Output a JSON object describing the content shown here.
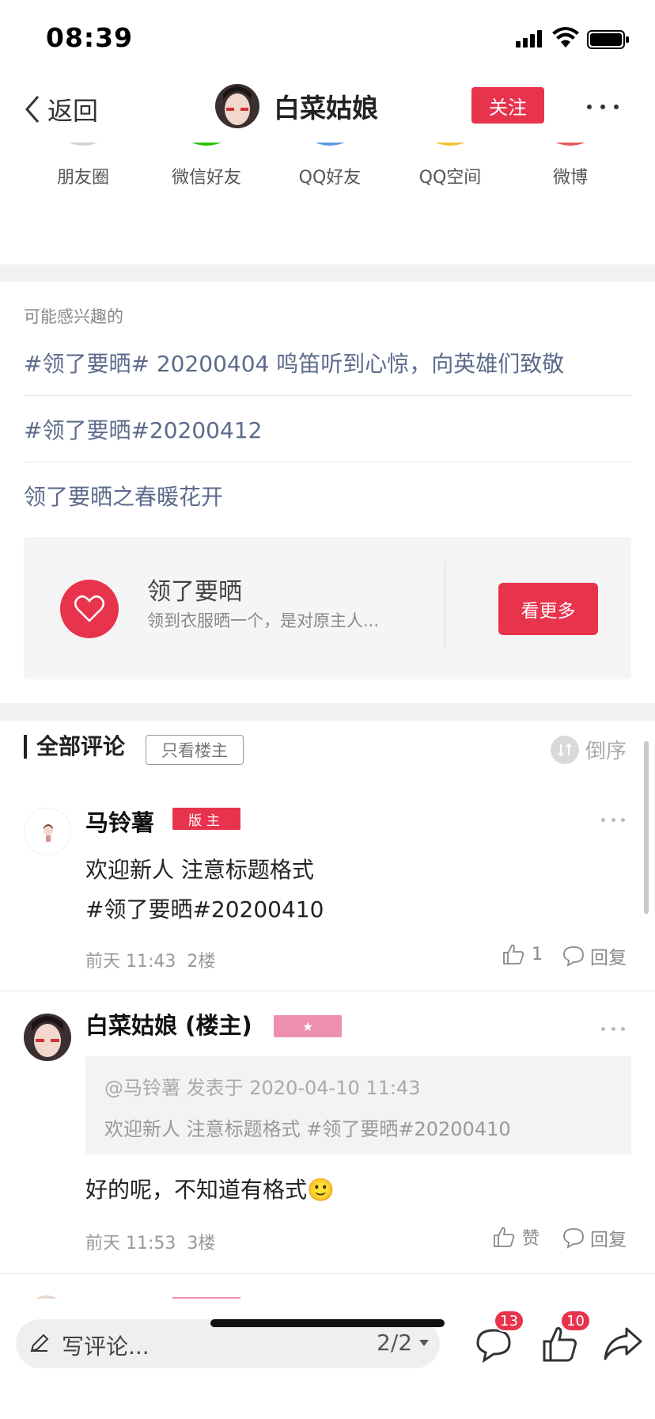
{
  "status_bar": {
    "time": "08:39"
  },
  "nav": {
    "back_label": "返回",
    "title": "白菜姑娘",
    "follow_label": "关注"
  },
  "share": {
    "items": [
      {
        "label": "朋友圈",
        "icon": "moments-icon",
        "color": "#a9d86e"
      },
      {
        "label": "微信好友",
        "icon": "wechat-icon",
        "color": "#2dc100"
      },
      {
        "label": "QQ好友",
        "icon": "qq-icon",
        "color": "#5b9be0"
      },
      {
        "label": "QQ空间",
        "icon": "qzone-icon",
        "color": "#f5c135"
      },
      {
        "label": "微博",
        "icon": "weibo-icon",
        "color": "#e85a5a"
      }
    ]
  },
  "interests": {
    "label": "可能感兴趣的",
    "topics": [
      "#领了要晒# 20200404 鸣笛听到心惊，向英雄们致敬",
      "#领了要晒#20200412",
      "领了要晒之春暖花开"
    ],
    "promo": {
      "title": "领了要晒",
      "description": "领到衣服晒一个，是对原主人...",
      "button": "看更多"
    }
  },
  "comments": {
    "title": "全部评论",
    "only_host": "只看楼主",
    "sort_label": "倒序",
    "items": [
      {
        "name": "马铃薯",
        "badge": "版主",
        "text_line1": "欢迎新人 注意标题格式",
        "text_line2": "#领了要晒#20200410",
        "time": "前天 11:43",
        "floor": "2楼",
        "likes": "1",
        "reply": "回复"
      },
      {
        "name": "白菜姑娘 (楼主)",
        "badge": "★",
        "quote_header": "@马铃薯 发表于 2020-04-10 11:43",
        "quote_text": "欢迎新人 注意标题格式 #领了要晒#20200410",
        "text": "好的呢，不知道有格式🙂",
        "time": "前天 11:53",
        "floor": "3楼",
        "likes": "赞",
        "reply": "回复"
      }
    ]
  },
  "bottom_bar": {
    "write_placeholder": "写评论...",
    "page": "2/2",
    "comment_count": "13",
    "like_count": "10"
  },
  "colors": {
    "accent": "#e8334d",
    "link": "#5d6b8c",
    "star_badge": "#ee8fae"
  }
}
